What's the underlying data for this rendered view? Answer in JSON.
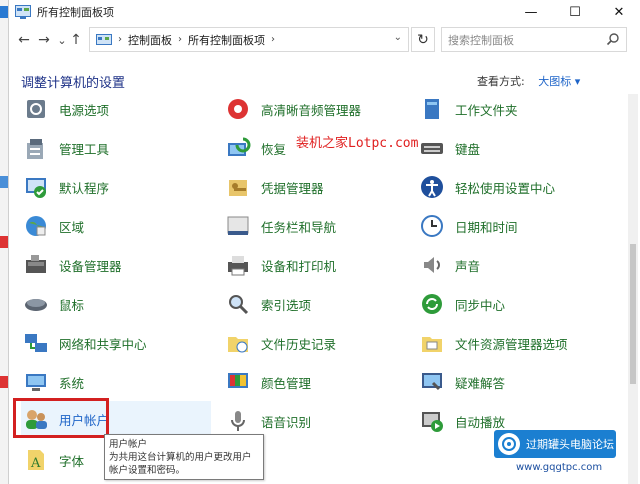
{
  "window": {
    "title": "所有控制面板项"
  },
  "titlebar": {
    "minimize": "—",
    "maximize": "☐",
    "close": "✕"
  },
  "nav": {
    "back": "←",
    "forward": "→",
    "dropdown": "⌄",
    "up": "↑",
    "refresh": "↻"
  },
  "breadcrumb": [
    "控制面板",
    "所有控制面板项"
  ],
  "search": {
    "placeholder": "搜索控制面板"
  },
  "heading": "调整计算机的设置",
  "view_by": {
    "label": "查看方式:",
    "value": "大图标 ▾"
  },
  "items": [
    {
      "label": "电源选项",
      "icon": "power-icon"
    },
    {
      "label": "高清晰音频管理器",
      "icon": "audio-manager-icon"
    },
    {
      "label": "工作文件夹",
      "icon": "work-folders-icon"
    },
    {
      "label": "管理工具",
      "icon": "admin-tools-icon"
    },
    {
      "label": "恢复",
      "icon": "recovery-icon"
    },
    {
      "label": "键盘",
      "icon": "keyboard-icon"
    },
    {
      "label": "默认程序",
      "icon": "default-programs-icon"
    },
    {
      "label": "凭据管理器",
      "icon": "credential-manager-icon"
    },
    {
      "label": "轻松使用设置中心",
      "icon": "ease-of-access-icon"
    },
    {
      "label": "区域",
      "icon": "region-icon"
    },
    {
      "label": "任务栏和导航",
      "icon": "taskbar-icon"
    },
    {
      "label": "日期和时间",
      "icon": "date-time-icon"
    },
    {
      "label": "设备管理器",
      "icon": "device-manager-icon"
    },
    {
      "label": "设备和打印机",
      "icon": "devices-printers-icon"
    },
    {
      "label": "声音",
      "icon": "sound-icon"
    },
    {
      "label": "鼠标",
      "icon": "mouse-icon"
    },
    {
      "label": "索引选项",
      "icon": "indexing-icon"
    },
    {
      "label": "同步中心",
      "icon": "sync-center-icon"
    },
    {
      "label": "网络和共享中心",
      "icon": "network-icon"
    },
    {
      "label": "文件历史记录",
      "icon": "file-history-icon"
    },
    {
      "label": "文件资源管理器选项",
      "icon": "explorer-options-icon"
    },
    {
      "label": "系统",
      "icon": "system-icon"
    },
    {
      "label": "颜色管理",
      "icon": "color-management-icon"
    },
    {
      "label": "疑难解答",
      "icon": "troubleshooting-icon"
    },
    {
      "label": "用户帐户",
      "icon": "user-accounts-icon"
    },
    {
      "label": "语音识别",
      "icon": "speech-recognition-icon"
    },
    {
      "label": "自动播放",
      "icon": "autoplay-icon"
    },
    {
      "label": "字体",
      "icon": "fonts-icon"
    }
  ],
  "selected_item": "用户帐户",
  "tooltip": {
    "title": "用户帐户",
    "description": "为共用这台计算机的用户更改用户帐户设置和密码。"
  },
  "watermark": {
    "text": "装机之家Lotpc.com"
  },
  "watermark2": {
    "text": "过期罐头电脑论坛",
    "url": "www.gqgtpc.com"
  },
  "colors": {
    "link_green": "#1f6f2a",
    "heading_blue": "#1e3287",
    "accent_blue": "#1e64c8",
    "highlight_red": "#d32020"
  }
}
